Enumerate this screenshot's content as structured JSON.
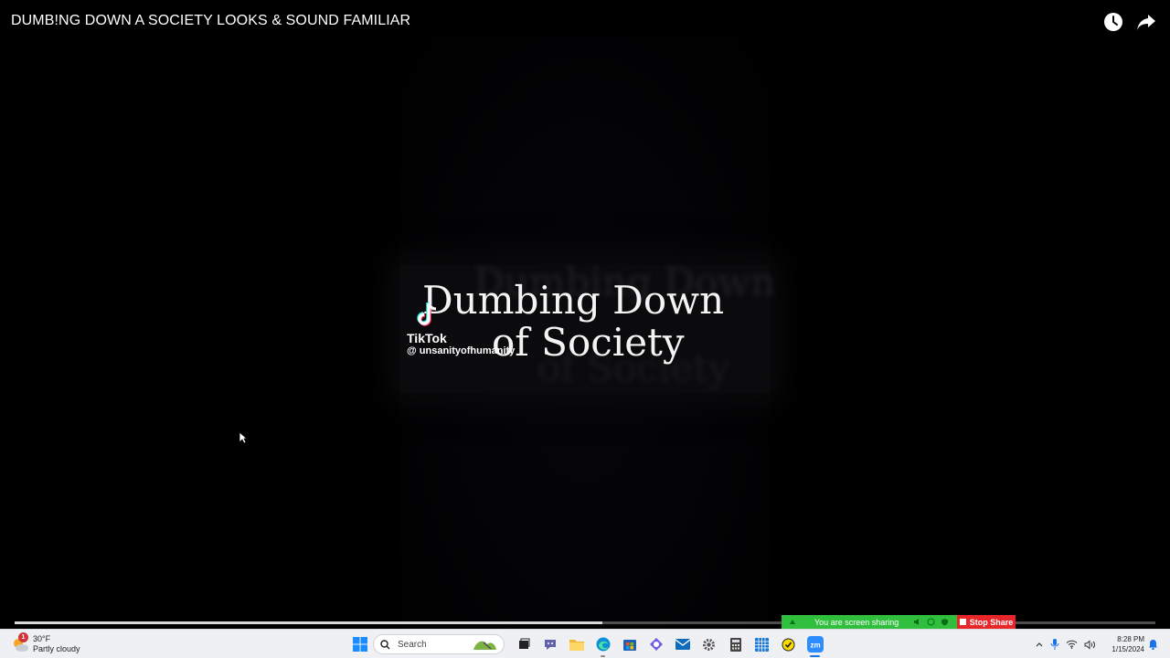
{
  "video": {
    "title": "DUMB!NG DOWN A SOCIETY LOOKS & SOUND FAMILIAR",
    "overlay_line1": "Dumbing Down",
    "overlay_line2": "of Society",
    "tiktok_label": "TikTok",
    "tiktok_handle": "@ unsanityofhumanity",
    "progress_fraction": 0.515,
    "top_buttons": [
      "watch-later-icon",
      "share-icon"
    ]
  },
  "screen_share": {
    "message": "You are screen sharing",
    "stop_label": "Stop Share",
    "colors": {
      "bar": "#2fbf3c",
      "stop": "#e8262a"
    }
  },
  "taskbar": {
    "weather": {
      "temp": "30°F",
      "condition": "Partly cloudy",
      "badge": "1"
    },
    "search_placeholder": "Search",
    "apps": [
      "windows-start-icon",
      "search-box",
      "task-view-icon",
      "chat-icon",
      "file-explorer-icon",
      "edge-icon",
      "store-icon",
      "copilot-icon",
      "mail-icon",
      "settings-icon",
      "calculator-icon",
      "calendar-icon",
      "norton-icon",
      "zoom-icon"
    ],
    "clock": {
      "time": "8:28 PM",
      "date": "1/15/2024"
    }
  }
}
